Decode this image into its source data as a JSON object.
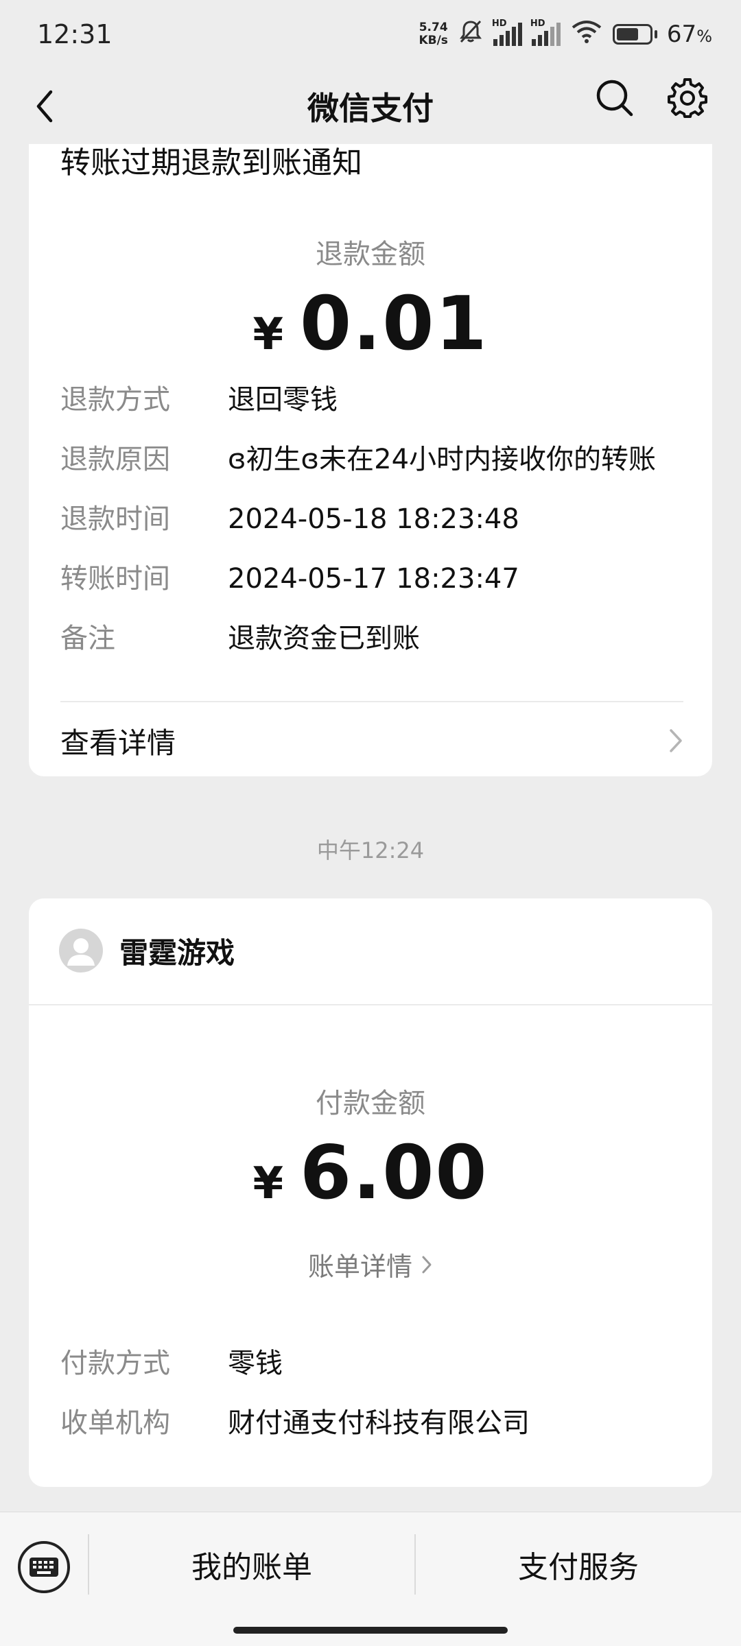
{
  "status_bar": {
    "time": "12:31",
    "net_speed_value": "5.74",
    "net_speed_unit": "KB/s",
    "hd_label": "HD",
    "battery_percent": 67,
    "battery_text": "67",
    "battery_unit": "%"
  },
  "nav": {
    "title": "微信支付"
  },
  "refund_card": {
    "title": "转账过期退款到账通知",
    "amount_label": "退款金额",
    "currency": "¥",
    "amount": "0.01",
    "rows": [
      {
        "key": "退款方式",
        "value": "退回零钱"
      },
      {
        "key": "退款原因",
        "value": "ɞ初生ɞ未在24小时内接收你的转账"
      },
      {
        "key": "退款时间",
        "value": "2024-05-18 18:23:48"
      },
      {
        "key": "转账时间",
        "value": "2024-05-17 18:23:47"
      },
      {
        "key": "备注",
        "value": "退款资金已到账"
      }
    ],
    "detail_link": "查看详情"
  },
  "time_separator": "中午12:24",
  "payment_card": {
    "merchant": "雷霆游戏",
    "amount_label": "付款金额",
    "currency": "¥",
    "amount": "6.00",
    "bill_detail": "账单详情",
    "rows": [
      {
        "key": "付款方式",
        "value": "零钱"
      },
      {
        "key": "收单机构",
        "value": "财付通支付科技有限公司"
      }
    ]
  },
  "bottom_bar": {
    "my_bills": "我的账单",
    "pay_services": "支付服务"
  }
}
